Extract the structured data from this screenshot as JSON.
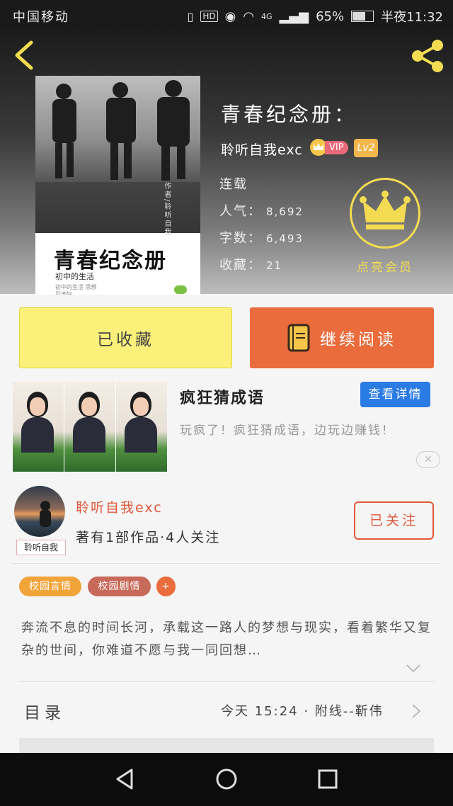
{
  "status_bar": {
    "carrier": "中国移动",
    "battery": "65%",
    "time": "半夜11:32",
    "network": "4G"
  },
  "book": {
    "title": "青春纪念册：",
    "cover_title": "青春纪念册",
    "cover_subtitle": "初中的生活",
    "cover_small": "初中的生活 思想见地好",
    "cover_side": "作者/聆听自我"
  },
  "author": {
    "name": "聆听自我exc",
    "vip": "VIP",
    "level": "Lv2"
  },
  "stats": {
    "status": "连载",
    "popularity_label": "人气：",
    "popularity": "8,692",
    "words_label": "字数：",
    "words": "6,493",
    "favorites_label": "收藏：",
    "favorites": "21"
  },
  "vip_promo": {
    "label": "点亮会员"
  },
  "actions": {
    "favorited": "已收藏",
    "continue_reading": "继续阅读"
  },
  "ad": {
    "title": "疯狂猜成语",
    "detail_button": "查看详情",
    "description": "玩疯了！疯狂猜成语，边玩边赚钱！",
    "close": "✕"
  },
  "author_card": {
    "name": "聆听自我exc",
    "meta": "著有1部作品·4人关注",
    "follow": "已关注",
    "avatar_tag": "聆听自我"
  },
  "tags": {
    "tag1": "校园言情",
    "tag2": "校园剧情",
    "add": "+"
  },
  "synopsis": "奔流不息的时间长河，承载这一路人的梦想与现实，看着繁华又复杂的世间，你难道不愿与我一同回想…",
  "toc": {
    "label": "目录",
    "latest": "今天 15:24 · 附线--靳伟"
  },
  "colors": {
    "accent_orange": "#ea6b3c",
    "accent_yellow": "#fbf17a",
    "vip_gold": "#f3dc52",
    "link_blue": "#2a7be4"
  }
}
